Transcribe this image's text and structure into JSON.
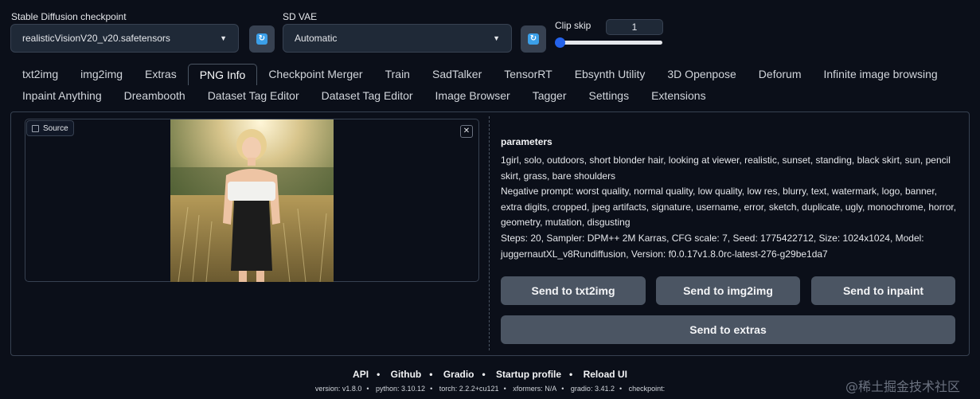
{
  "settings": {
    "checkpoint_label": "Stable Diffusion checkpoint",
    "checkpoint_value": "realisticVisionV20_v20.safetensors",
    "vae_label": "SD VAE",
    "vae_value": "Automatic",
    "clip_label": "Clip skip",
    "clip_value": "1",
    "refresh_icon": "refresh-icon"
  },
  "tabs_row1": [
    "txt2img",
    "img2img",
    "Extras",
    "PNG Info",
    "Checkpoint Merger",
    "Train",
    "SadTalker",
    "TensorRT",
    "Ebsynth Utility",
    "3D Openpose",
    "Deforum",
    "Infinite image browsing"
  ],
  "tabs_row2": [
    "Inpaint Anything",
    "Dreambooth",
    "Dataset Tag Editor",
    "Dataset Tag Editor",
    "Image Browser",
    "Tagger",
    "Settings",
    "Extensions"
  ],
  "active_tab": "PNG Info",
  "source": {
    "label": "Source",
    "close": "✕"
  },
  "params": {
    "title": "parameters",
    "prompt": "1girl, solo, outdoors, short blonder hair, looking at viewer, realistic, sunset, standing, black skirt, sun, pencil skirt, grass, bare shoulders",
    "negative": "Negative prompt: worst quality, normal quality, low quality, low res, blurry, text, watermark, logo, banner, extra digits, cropped, jpeg artifacts, signature, username, error, sketch, duplicate, ugly, monochrome, horror, geometry, mutation, disgusting",
    "settings": "Steps: 20, Sampler: DPM++ 2M Karras, CFG scale: 7, Seed: 1775422712, Size: 1024x1024, Model: juggernautXL_v8Rundiffusion, Version: f0.0.17v1.8.0rc-latest-276-g29be1da7"
  },
  "buttons": {
    "txt2img": "Send to txt2img",
    "img2img": "Send to img2img",
    "inpaint": "Send to inpaint",
    "extras": "Send to extras"
  },
  "footer": {
    "links": [
      "API",
      "Github",
      "Gradio",
      "Startup profile",
      "Reload UI"
    ],
    "versions": [
      "version: v1.8.0",
      "python: 3.10.12",
      "torch: 2.2.2+cu121",
      "xformers: N/A",
      "gradio: 3.41.2",
      "checkpoint:"
    ]
  },
  "watermark": "@稀土掘金技术社区",
  "colors": {
    "background": "#0b0f19",
    "accent": "#2563eb",
    "button": "#4b5563"
  }
}
